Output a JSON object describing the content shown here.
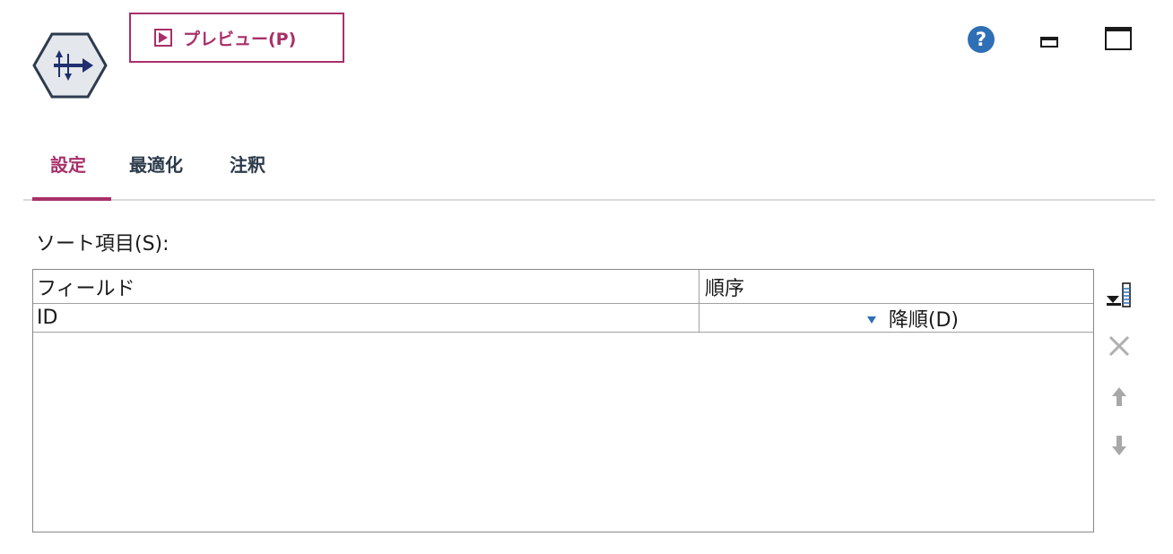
{
  "header": {
    "node_icon": "sort-node-icon",
    "preview_button": {
      "label": "プレビュー(P)",
      "icon": "play-icon",
      "color": "#a8306a"
    },
    "help_icon": "help-icon",
    "minimize_icon": "minimize-icon",
    "maximize_icon": "maximize-icon"
  },
  "tabs": [
    {
      "label": "設定",
      "active": true
    },
    {
      "label": "最適化",
      "active": false
    },
    {
      "label": "注釈",
      "active": false
    }
  ],
  "sort_section": {
    "label": "ソート項目(S):",
    "columns": [
      "フィールド",
      "順序"
    ],
    "rows": [
      {
        "field": "ID",
        "order": "降順(D)",
        "order_icon": "sort-descending-icon"
      }
    ]
  },
  "side_tools": [
    "add-field-icon",
    "delete-icon",
    "move-up-icon",
    "move-down-icon"
  ],
  "colors": {
    "accent": "#a8306a",
    "help": "#2f6fb5",
    "tab_text": "#2b3a4a"
  }
}
